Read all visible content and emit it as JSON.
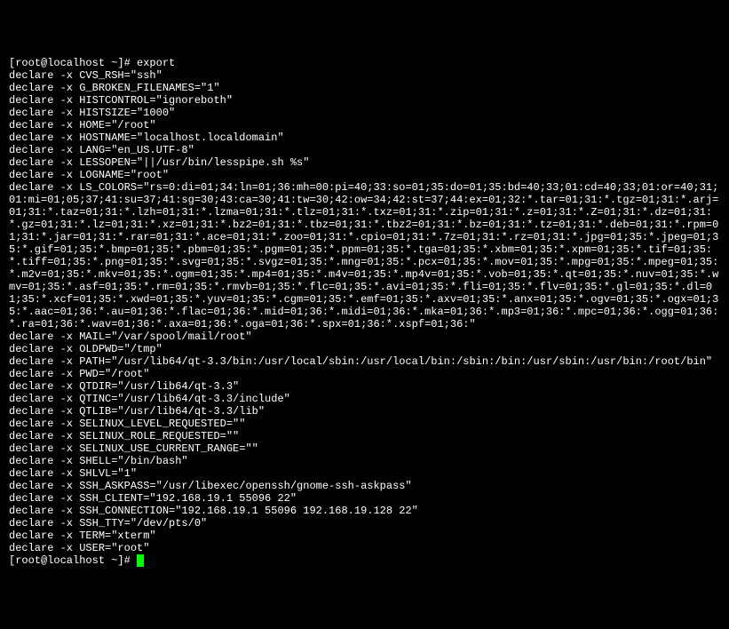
{
  "prompt_start": "[root@localhost ~]# ",
  "command": "export",
  "lines": [
    "declare -x CVS_RSH=\"ssh\"",
    "declare -x G_BROKEN_FILENAMES=\"1\"",
    "declare -x HISTCONTROL=\"ignoreboth\"",
    "declare -x HISTSIZE=\"1000\"",
    "declare -x HOME=\"/root\"",
    "declare -x HOSTNAME=\"localhost.localdomain\"",
    "declare -x LANG=\"en_US.UTF-8\"",
    "declare -x LESSOPEN=\"||/usr/bin/lesspipe.sh %s\"",
    "declare -x LOGNAME=\"root\"",
    "declare -x LS_COLORS=\"rs=0:di=01;34:ln=01;36:mh=00:pi=40;33:so=01;35:do=01;35:bd=40;33;01:cd=40;33;01:or=40;31;01:mi=01;05;37;41:su=37;41:sg=30;43:ca=30;41:tw=30;42:ow=34;42:st=37;44:ex=01;32:*.tar=01;31:*.tgz=01;31:*.arj=01;31:*.taz=01;31:*.lzh=01;31:*.lzma=01;31:*.tlz=01;31:*.txz=01;31:*.zip=01;31:*.z=01;31:*.Z=01;31:*.dz=01;31:*.gz=01;31:*.lz=01;31:*.xz=01;31:*.bz2=01;31:*.tbz=01;31:*.tbz2=01;31:*.bz=01;31:*.tz=01;31:*.deb=01;31:*.rpm=01;31:*.jar=01;31:*.rar=01;31:*.ace=01;31:*.zoo=01;31:*.cpio=01;31:*.7z=01;31:*.rz=01;31:*.jpg=01;35:*.jpeg=01;35:*.gif=01;35:*.bmp=01;35:*.pbm=01;35:*.pgm=01;35:*.ppm=01;35:*.tga=01;35:*.xbm=01;35:*.xpm=01;35:*.tif=01;35:*.tiff=01;35:*.png=01;35:*.svg=01;35:*.svgz=01;35:*.mng=01;35:*.pcx=01;35:*.mov=01;35:*.mpg=01;35:*.mpeg=01;35:*.m2v=01;35:*.mkv=01;35:*.ogm=01;35:*.mp4=01;35:*.m4v=01;35:*.mp4v=01;35:*.vob=01;35:*.qt=01;35:*.nuv=01;35:*.wmv=01;35:*.asf=01;35:*.rm=01;35:*.rmvb=01;35:*.flc=01;35:*.avi=01;35:*.fli=01;35:*.flv=01;35:*.gl=01;35:*.dl=01;35:*.xcf=01;35:*.xwd=01;35:*.yuv=01;35:*.cgm=01;35:*.emf=01;35:*.axv=01;35:*.anx=01;35:*.ogv=01;35:*.ogx=01;35:*.aac=01;36:*.au=01;36:*.flac=01;36:*.mid=01;36:*.midi=01;36:*.mka=01;36:*.mp3=01;36:*.mpc=01;36:*.ogg=01;36:*.ra=01;36:*.wav=01;36:*.axa=01;36:*.oga=01;36:*.spx=01;36:*.xspf=01;36:\"",
    "declare -x MAIL=\"/var/spool/mail/root\"",
    "declare -x OLDPWD=\"/tmp\"",
    "declare -x PATH=\"/usr/lib64/qt-3.3/bin:/usr/local/sbin:/usr/local/bin:/sbin:/bin:/usr/sbin:/usr/bin:/root/bin\"",
    "declare -x PWD=\"/root\"",
    "declare -x QTDIR=\"/usr/lib64/qt-3.3\"",
    "declare -x QTINC=\"/usr/lib64/qt-3.3/include\"",
    "declare -x QTLIB=\"/usr/lib64/qt-3.3/lib\"",
    "declare -x SELINUX_LEVEL_REQUESTED=\"\"",
    "declare -x SELINUX_ROLE_REQUESTED=\"\"",
    "declare -x SELINUX_USE_CURRENT_RANGE=\"\"",
    "declare -x SHELL=\"/bin/bash\"",
    "declare -x SHLVL=\"1\"",
    "declare -x SSH_ASKPASS=\"/usr/libexec/openssh/gnome-ssh-askpass\"",
    "declare -x SSH_CLIENT=\"192.168.19.1 55096 22\"",
    "declare -x SSH_CONNECTION=\"192.168.19.1 55096 192.168.19.128 22\"",
    "declare -x SSH_TTY=\"/dev/pts/0\"",
    "declare -x TERM=\"xterm\"",
    "declare -x USER=\"root\""
  ],
  "prompt_end": "[root@localhost ~]# "
}
